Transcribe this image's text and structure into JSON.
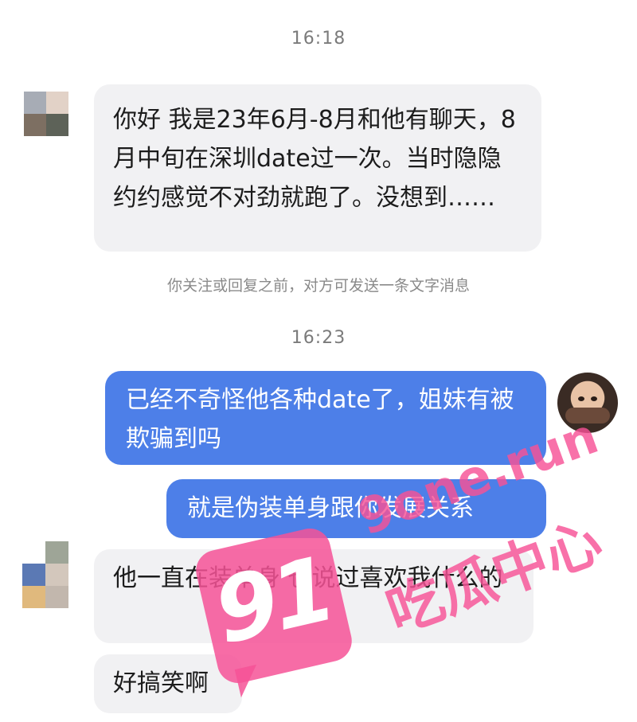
{
  "timestamps": [
    "16:18",
    "16:23"
  ],
  "messages": {
    "in1": "你好 我是23年6月-8月和他有聊天，8月中旬在深圳date过一次。当时隐隐约约感觉不对劲就跑了。没想到……",
    "notice": "你关注或回复之前，对方可发送一条文字消息",
    "out1": "已经不奇怪他各种date了，姐妹有被欺骗到吗",
    "out2": "就是伪装单身跟你发展关系",
    "in2": "他一直在装单身 也说过喜欢我什么的",
    "in3": "好搞笑啊"
  },
  "watermark": {
    "badge": "91",
    "url": "9one.run",
    "name": "吃瓜中心"
  },
  "colors": {
    "outgoing_bubble": "#4d7fe8",
    "incoming_bubble": "#f1f1f3",
    "watermark": "#f65296"
  }
}
